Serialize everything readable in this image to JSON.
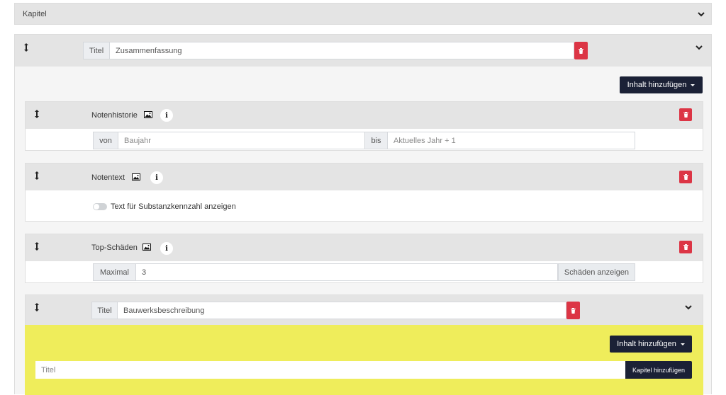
{
  "kapitel": {
    "label": "Kapitel"
  },
  "chapter": {
    "title_addon": "Titel",
    "title_value": "Zusammenfassung",
    "add_content_label": "Inhalt hinzufügen",
    "blocks": {
      "notenhistorie": {
        "title": "Notenhistorie",
        "von_label": "von",
        "von_placeholder": "Baujahr",
        "bis_label": "bis",
        "bis_placeholder": "Aktuelles Jahr + 1"
      },
      "notentext": {
        "title": "Notentext",
        "toggle_label": "Text für Substanzkennzahl anzeigen"
      },
      "top_schaeden": {
        "title": "Top-Schäden",
        "max_label": "Maximal",
        "max_value": "3",
        "show_button": "Schäden anzeigen"
      }
    },
    "sub_chapter": {
      "title_addon": "Titel",
      "title_value": "Bauwerksbeschreibung",
      "add_content_label": "Inhalt hinzufügen",
      "new_title_placeholder": "Titel",
      "add_chapter_button": "Kapitel hinzufügen"
    }
  },
  "colors": {
    "navy": "#1b2136",
    "danger": "#dc3545",
    "highlight": "#efed5b",
    "header_gray": "#e4e4e4"
  },
  "icons": [
    "drag-handle-icon",
    "chevron-down-icon",
    "trash-icon",
    "image-icon",
    "info-icon"
  ]
}
